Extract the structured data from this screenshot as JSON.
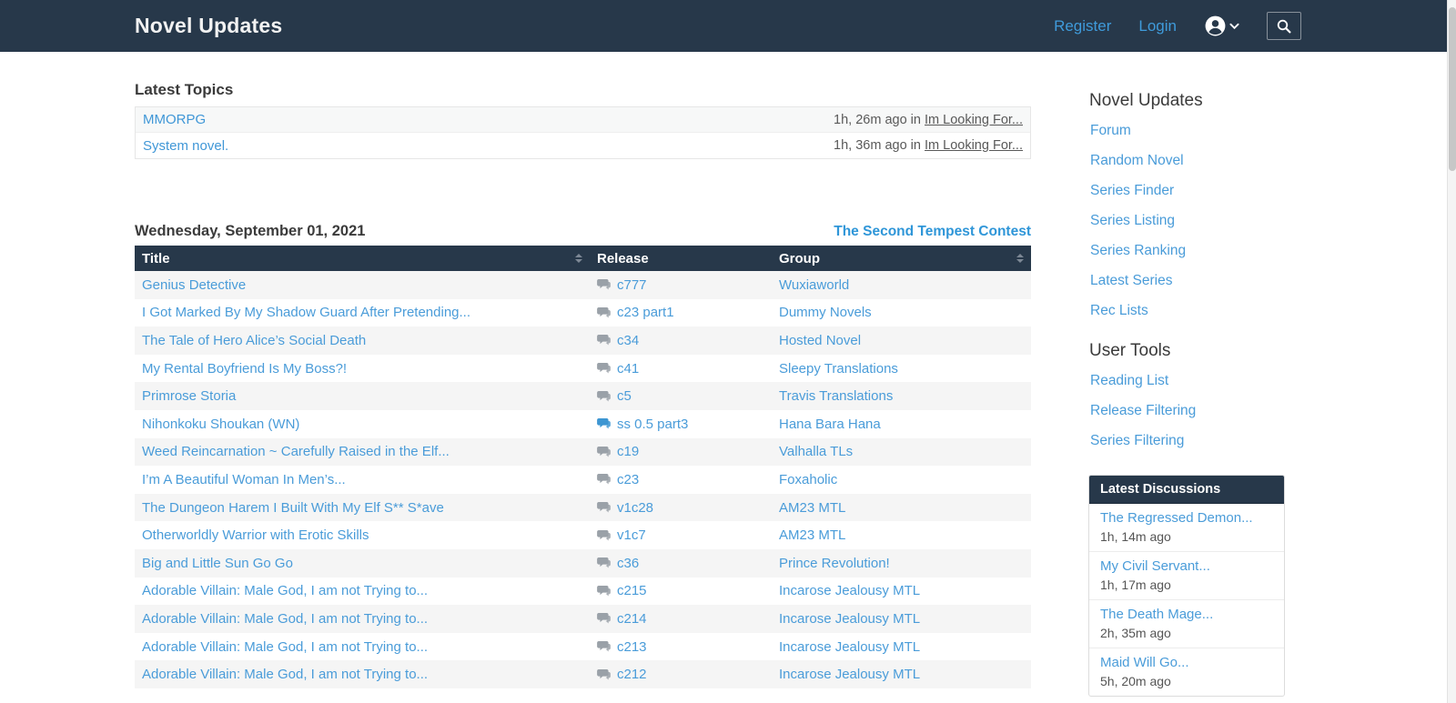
{
  "navbar": {
    "title": "Novel Updates",
    "register": "Register",
    "login": "Login"
  },
  "latest_topics": {
    "heading": "Latest Topics",
    "rows": [
      {
        "topic": "MMORPG",
        "time": "1h, 26m ago in ",
        "forum": "Im Looking For..."
      },
      {
        "topic": "System novel.",
        "time": "1h, 36m ago in ",
        "forum": "Im Looking For..."
      }
    ]
  },
  "main": {
    "date": "Wednesday, September 01, 2021",
    "contest_link": "The Second Tempest Contest",
    "table": {
      "columns": [
        "Title",
        "Release",
        "Group"
      ],
      "rows": [
        {
          "title": "Genius Detective",
          "release": "c777",
          "group": "Wuxiaworld",
          "icon": "gray"
        },
        {
          "title": "I Got Marked By My Shadow Guard After Pretending...",
          "release": "c23 part1",
          "group": "Dummy Novels",
          "icon": "gray"
        },
        {
          "title": "The Tale of Hero Alice’s Social Death",
          "release": "c34",
          "group": "Hosted Novel",
          "icon": "gray"
        },
        {
          "title": "My Rental Boyfriend Is My Boss?!",
          "release": "c41",
          "group": "Sleepy Translations",
          "icon": "gray"
        },
        {
          "title": "Primrose Storia",
          "release": "c5",
          "group": "Travis Translations",
          "icon": "gray"
        },
        {
          "title": "Nihonkoku Shoukan (WN)",
          "release": "ss 0.5 part3",
          "group": "Hana Bara Hana",
          "icon": "blue"
        },
        {
          "title": "Weed Reincarnation ~ Carefully Raised in the Elf...",
          "release": "c19",
          "group": "Valhalla TLs",
          "icon": "gray"
        },
        {
          "title": "I’m A Beautiful Woman In Men’s...",
          "release": "c23",
          "group": "Foxaholic",
          "icon": "gray"
        },
        {
          "title": "The Dungeon Harem I Built With My Elf S** S*ave",
          "release": "v1c28",
          "group": "AM23 MTL",
          "icon": "gray"
        },
        {
          "title": "Otherworldly Warrior with Erotic Skills",
          "release": "v1c7",
          "group": "AM23 MTL",
          "icon": "gray"
        },
        {
          "title": "Big and Little Sun Go Go",
          "release": "c36",
          "group": "Prince Revolution!",
          "icon": "gray"
        },
        {
          "title": "Adorable Villain: Male God, I am not Trying to...",
          "release": "c215",
          "group": "Incarose Jealousy MTL",
          "icon": "gray"
        },
        {
          "title": "Adorable Villain: Male God, I am not Trying to...",
          "release": "c214",
          "group": "Incarose Jealousy MTL",
          "icon": "gray"
        },
        {
          "title": "Adorable Villain: Male God, I am not Trying to...",
          "release": "c213",
          "group": "Incarose Jealousy MTL",
          "icon": "gray"
        },
        {
          "title": "Adorable Villain: Male God, I am not Trying to...",
          "release": "c212",
          "group": "Incarose Jealousy MTL",
          "icon": "gray"
        }
      ]
    }
  },
  "sidebar": {
    "nav": {
      "heading": "Novel Updates",
      "items": [
        "Forum",
        "Random Novel",
        "Series Finder",
        "Series Listing",
        "Series Ranking",
        "Latest Series",
        "Rec Lists"
      ]
    },
    "tools": {
      "heading": "User Tools",
      "items": [
        "Reading List",
        "Release Filtering",
        "Series Filtering"
      ]
    },
    "discussions": {
      "heading": "Latest Discussions",
      "items": [
        {
          "title": "The Regressed Demon...",
          "time": "1h, 14m ago"
        },
        {
          "title": "My Civil Servant...",
          "time": "1h, 17m ago"
        },
        {
          "title": "The Death Mage...",
          "time": "2h, 35m ago"
        },
        {
          "title": "Maid Will Go...",
          "time": "5h, 20m ago"
        }
      ]
    }
  },
  "colors": {
    "navbar_bg": "#27384a",
    "link_blue": "#4a9cd9",
    "stripe_gray": "#f5f5f5"
  }
}
